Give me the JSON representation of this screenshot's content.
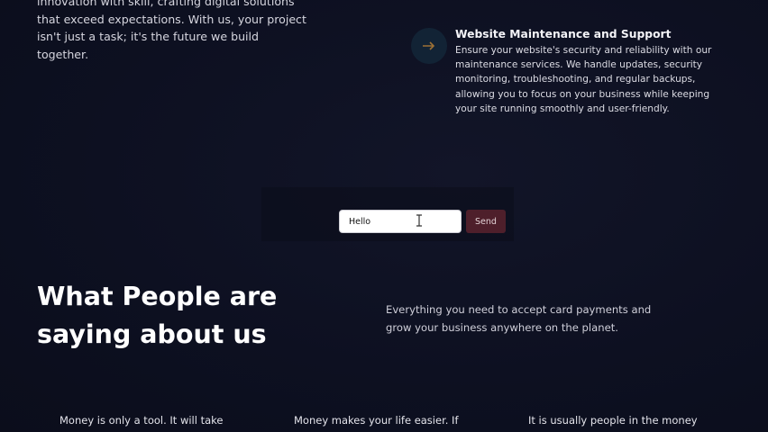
{
  "intro": {
    "text": "innovation with skill, crafting digital solutions that exceed expectations. With us, your project isn't just a task; it's the future we build together."
  },
  "service": {
    "icon": "arrow-icon",
    "title": "Website Maintenance and Support",
    "description": "Ensure your website's security and reliability with our maintenance services. We handle updates, security monitoring, troubleshooting, and regular backups, allowing you to focus on your business while keeping your site running smoothly and user-friendly."
  },
  "chat": {
    "input_value": "Hello",
    "send_label": "Send"
  },
  "testimonials": {
    "heading": "What People are saying about us",
    "subtext": "Everything you need to accept card payments and grow your business anywhere on the planet.",
    "quotes": [
      "Money is only a tool. It will take",
      "Money makes your life easier. If",
      "It is usually people in the money"
    ]
  },
  "colors": {
    "background": "#0d1021",
    "send_button": "#4e1f2b",
    "text": "#e9e9ef"
  }
}
